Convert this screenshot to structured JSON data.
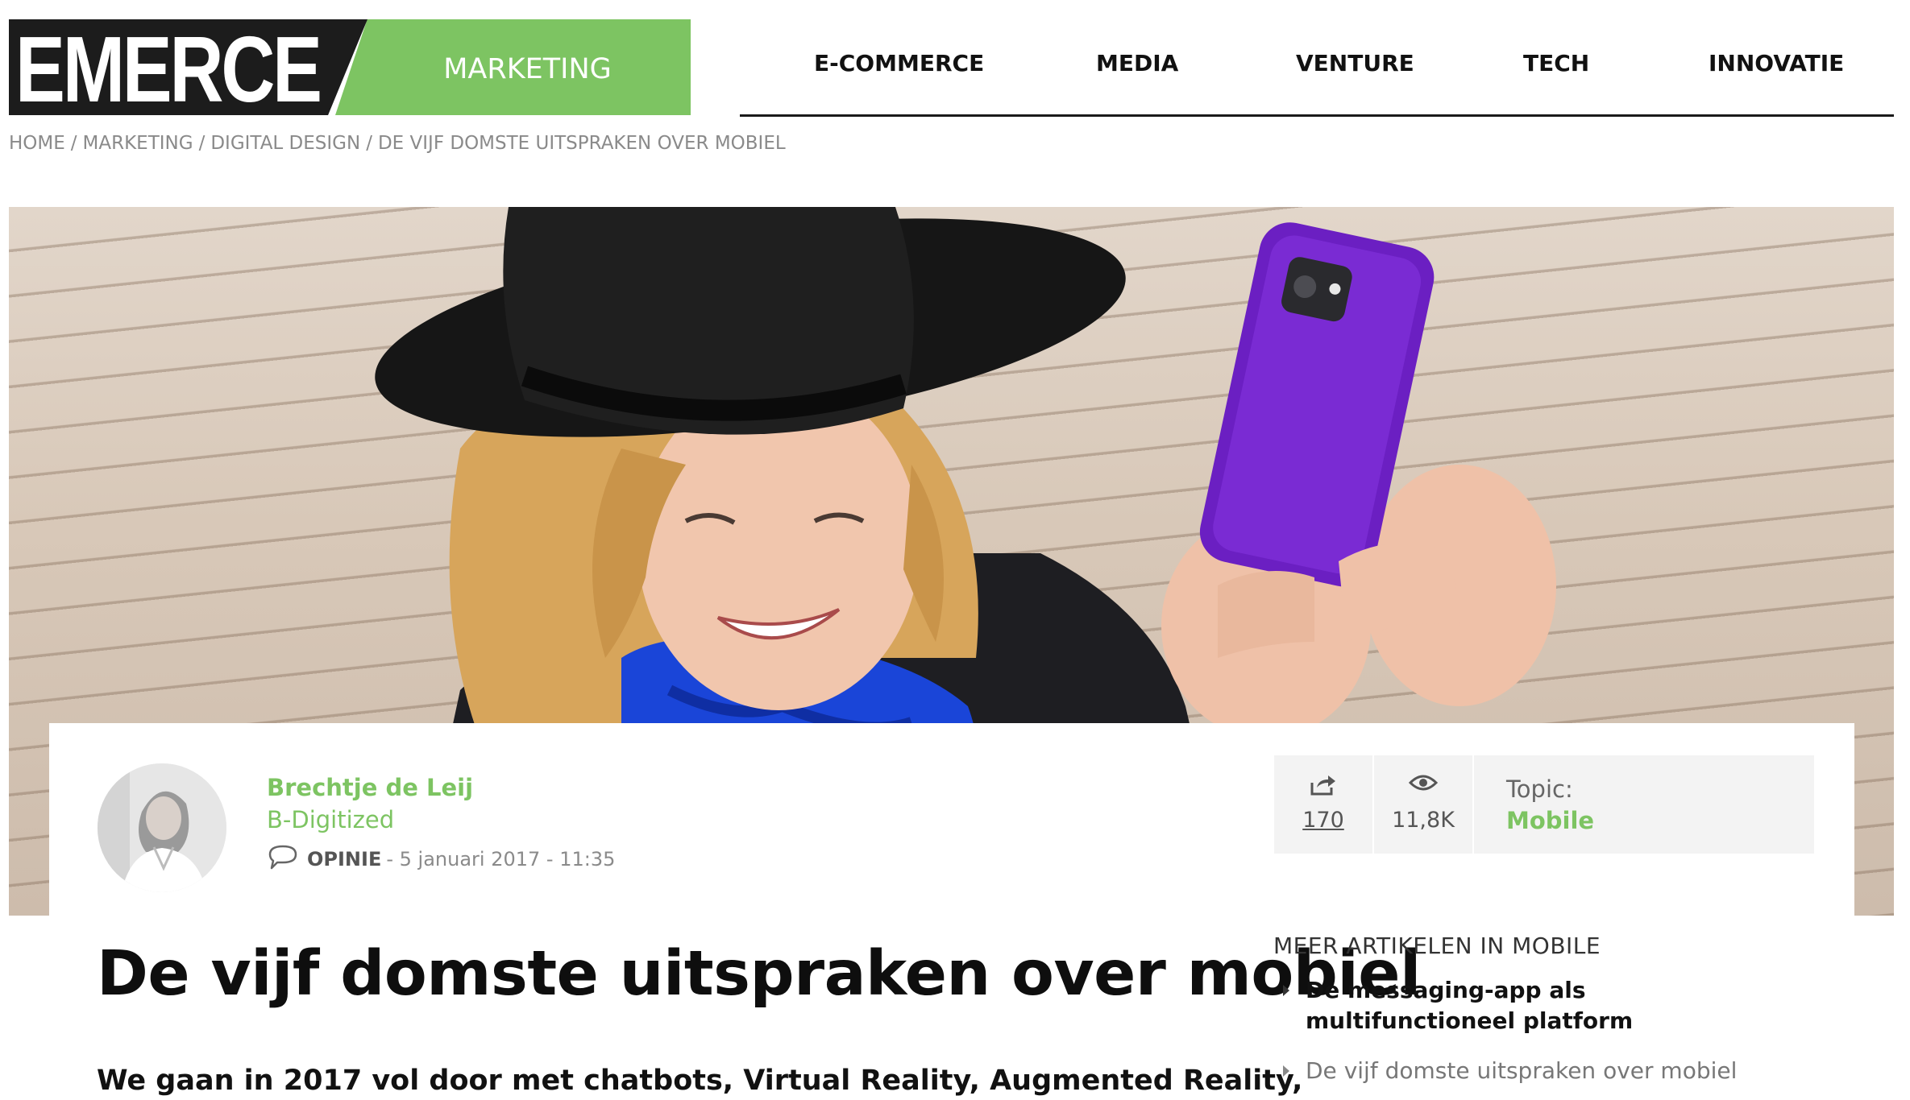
{
  "brand": {
    "logo": "EMERCE",
    "section": "MARKETING"
  },
  "nav": {
    "items": [
      "E-COMMERCE",
      "MEDIA",
      "VENTURE",
      "TECH",
      "INNOVATIE"
    ]
  },
  "breadcrumb": [
    "HOME",
    "MARKETING",
    "DIGITAL DESIGN",
    "DE VIJF DOMSTE UITSPRAKEN OVER MOBIEL"
  ],
  "author": {
    "name": "Brechtje de Leij",
    "company": "B-Digitized",
    "type": "OPINIE",
    "date": "- 5 januari 2017 - 11:35"
  },
  "stats": {
    "shares": "170",
    "views": "11,8K"
  },
  "topic": {
    "label": "Topic:",
    "value": "Mobile"
  },
  "article": {
    "title": "De vijf domste uitspraken over mobiel",
    "lead": "We gaan in 2017 vol door met chatbots, Virtual Reality, Augmented Reality,"
  },
  "sidebar": {
    "heading": "MEER ARTIKELEN IN MOBILE",
    "items": [
      "De messaging-app als multifunctioneel platform",
      "De vijf domste uitspraken over mobiel"
    ]
  },
  "colors": {
    "accent": "#7dc462",
    "logo_dark": "#1c1c1c",
    "text": "#111111",
    "muted": "#8a8a8a"
  }
}
